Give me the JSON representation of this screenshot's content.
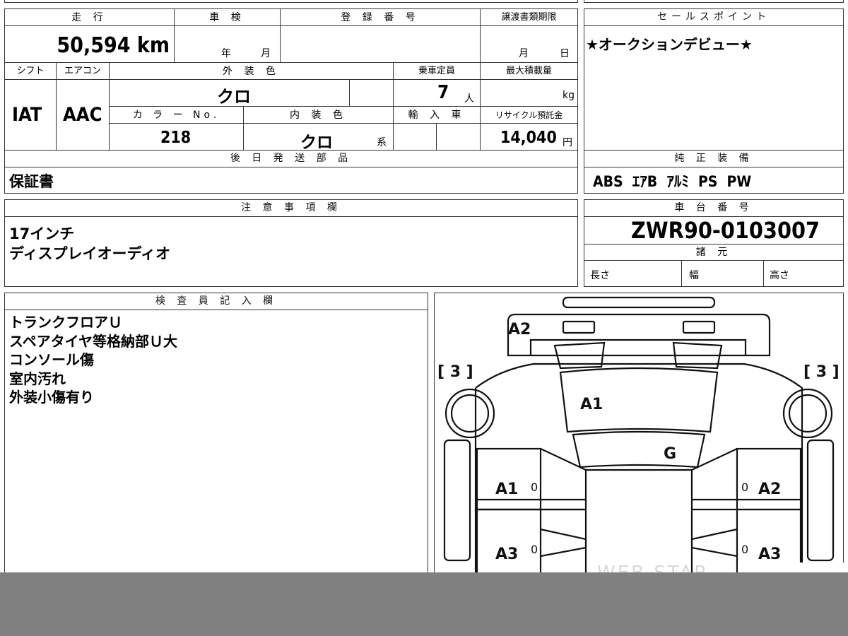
{
  "top": {
    "mileage_label": "走 行",
    "mileage_value": "50,594 km",
    "inspection_label": "車 検",
    "inspection_year": "年",
    "inspection_month": "月",
    "registration_label": "登 録 番 号",
    "transfer_label": "譲渡書類期限",
    "transfer_month": "月",
    "transfer_day": "日"
  },
  "sales": {
    "label": "セールスポイント",
    "text": "★オークションデビュー★"
  },
  "spec": {
    "shift_label": "シフト",
    "shift_value": "IAT",
    "ac_label": "エアコン",
    "ac_value": "AAC",
    "exterior_label": "外 装 色",
    "exterior_value": "クロ",
    "capacity_label": "乗車定員",
    "capacity_value": "7",
    "capacity_unit": "人",
    "maxload_label": "最大積載量",
    "maxload_unit": "kg",
    "color_no_label": "カ ラ ー No.",
    "color_no_value": "218",
    "interior_label": "内 装 色",
    "interior_value": "クロ",
    "interior_suffix": "系",
    "import_label": "輸 入 車",
    "recycle_label": "リサイクル預託金",
    "recycle_value": "14,040",
    "recycle_unit": "円"
  },
  "shipping": {
    "label": "後 日 発 送 部 品",
    "value": "保証書"
  },
  "equipment": {
    "label": "純 正 装 備",
    "value": "ABS  ｴｱB  ｱﾙﾐ  PS  PW"
  },
  "notes": {
    "label": "注 意 事 項 欄",
    "line1": "17インチ",
    "line2": "ディスプレイオーディオ"
  },
  "chassis": {
    "label": "車 台 番 号",
    "value": "ZWR90-0103007"
  },
  "dimensions": {
    "label": "諸 元",
    "length": "長さ",
    "width": "幅",
    "height": "高さ"
  },
  "inspector": {
    "label": "検 査 員 記 入 欄",
    "lines": [
      "トランクフロアＵ",
      "スペアタイヤ等格納部Ｕ大",
      "コンソール傷",
      "室内汚れ",
      "外装小傷有り"
    ]
  },
  "diagram": {
    "left_bracket": "[ 3 ]",
    "right_bracket": "[ 3 ]",
    "marks": {
      "a2_top": "A2",
      "a1_roof": "A1",
      "g_glass": "G",
      "a1_left": "A1",
      "a2_right": "A2",
      "a3_left": "A3",
      "a3_right": "A3",
      "zero_1": "0",
      "zero_2": "0",
      "zero_3": "0",
      "zero_4": "0"
    },
    "watermark": "WEB STAR"
  }
}
